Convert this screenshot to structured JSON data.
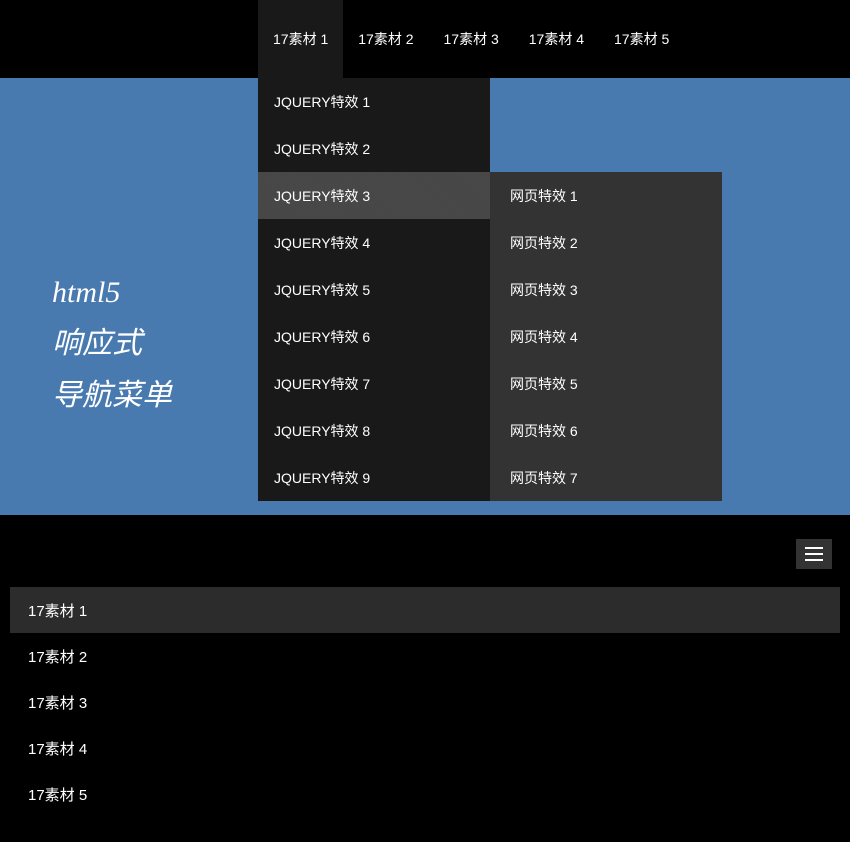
{
  "topNav": [
    {
      "label": "17素材 1",
      "active": true
    },
    {
      "label": "17素材 2",
      "active": false
    },
    {
      "label": "17素材 3",
      "active": false
    },
    {
      "label": "17素材 4",
      "active": false
    },
    {
      "label": "17素材 5",
      "active": false
    }
  ],
  "hero": {
    "line1": "html5",
    "line2": "响应式",
    "line3": "导航菜单"
  },
  "dropdown": [
    {
      "label": "JQUERY特效 1",
      "hover": false
    },
    {
      "label": "JQUERY特效 2",
      "hover": false
    },
    {
      "label": "JQUERY特效 3",
      "hover": true
    },
    {
      "label": "JQUERY特效 4",
      "hover": false
    },
    {
      "label": "JQUERY特效 5",
      "hover": false
    },
    {
      "label": "JQUERY特效 6",
      "hover": false
    },
    {
      "label": "JQUERY特效 7",
      "hover": false
    },
    {
      "label": "JQUERY特效 8",
      "hover": false
    },
    {
      "label": "JQUERY特效 9",
      "hover": false
    }
  ],
  "submenu": [
    {
      "label": "网页特效 1"
    },
    {
      "label": "网页特效 2"
    },
    {
      "label": "网页特效 3"
    },
    {
      "label": "网页特效 4"
    },
    {
      "label": "网页特效 5"
    },
    {
      "label": "网页特效 6"
    },
    {
      "label": "网页特效 7"
    }
  ],
  "mobileNav": [
    {
      "label": "17素材 1",
      "active": true
    },
    {
      "label": "17素材 2",
      "active": false
    },
    {
      "label": "17素材 3",
      "active": false
    },
    {
      "label": "17素材 4",
      "active": false
    },
    {
      "label": "17素材 5",
      "active": false
    }
  ]
}
